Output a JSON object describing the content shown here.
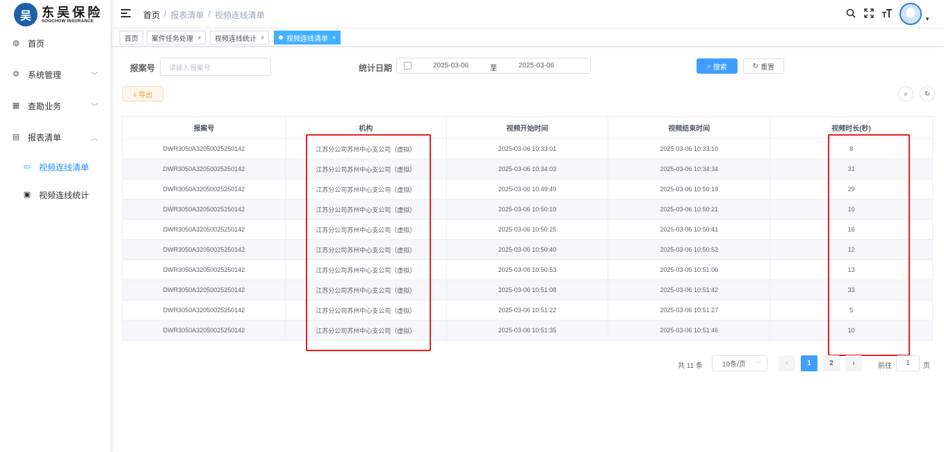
{
  "brand": {
    "name_cn": "东吴保险",
    "name_en": "SOOCHOW INSURANCE",
    "mark": "吴"
  },
  "sidebar": {
    "items": [
      {
        "label": "首页",
        "icon": "dashboard-icon"
      },
      {
        "label": "系统管理",
        "icon": "gear-icon"
      },
      {
        "label": "查勘业务",
        "icon": "grid-icon"
      },
      {
        "label": "报表清单",
        "icon": "report-icon"
      }
    ],
    "sub_items": [
      {
        "label": "视频连线清单",
        "icon": "monitor-icon",
        "active": true
      },
      {
        "label": "视频连线统计",
        "icon": "chart-icon",
        "active": false
      }
    ]
  },
  "header": {
    "breadcrumb": [
      "首页",
      "/",
      "报表清单",
      "/",
      "视频连线清单"
    ],
    "icons": [
      "search-icon",
      "fullscreen-icon",
      "font-size-icon"
    ]
  },
  "tags": [
    {
      "label": "首页",
      "closable": false
    },
    {
      "label": "案件任务处理",
      "closable": true
    },
    {
      "label": "视频连线统计",
      "closable": true
    },
    {
      "label": "视频连线清单",
      "closable": true,
      "active": true
    }
  ],
  "search": {
    "report_label": "报案号",
    "report_placeholder": "请输入报案号",
    "date_label": "统计日期",
    "date_start": "2025-03-06",
    "date_sep": "至",
    "date_end": "2025-03-06",
    "search_btn": "搜索",
    "reset_btn": "重置",
    "export_btn": "导出"
  },
  "table": {
    "headers": [
      "报案号",
      "机构",
      "视频开始时间",
      "视频结束时间",
      "视频时长(秒)"
    ],
    "rows": [
      [
        "DWR3050A32050025250142",
        "江苏分公司苏州中心支公司（虚拟）",
        "2025-03-06 10:33:01",
        "2025-03-06 10:33:10",
        "8"
      ],
      [
        "DWR3050A32050025250142",
        "江苏分公司苏州中心支公司（虚拟）",
        "2025-03-06 10:34:03",
        "2025-03-06 10:34:34",
        "31"
      ],
      [
        "DWR3050A32050025250142",
        "江苏分公司苏州中心支公司（虚拟）",
        "2025-03-06 10:49:49",
        "2025-03-06 10:50:19",
        "29"
      ],
      [
        "DWR3050A32050025250142",
        "江苏分公司苏州中心支公司（虚拟）",
        "2025-03-06 10:50:10",
        "2025-03-06 10:50:21",
        "10"
      ],
      [
        "DWR3050A32050025250142",
        "江苏分公司苏州中心支公司（虚拟）",
        "2025-03-06 10:50:25",
        "2025-03-06 10:50:41",
        "16"
      ],
      [
        "DWR3050A32050025250142",
        "江苏分公司苏州中心支公司（虚拟）",
        "2025-03-06 10:50:40",
        "2025-03-06 10:50:52",
        "12"
      ],
      [
        "DWR3050A32050025250142",
        "江苏分公司苏州中心支公司（虚拟）",
        "2025-03-06 10:50:53",
        "2025-03-06 10:51:06",
        "13"
      ],
      [
        "DWR3050A32050025250142",
        "江苏分公司苏州中心支公司（虚拟）",
        "2025-03-06 10:51:08",
        "2025-03-06 10:51:42",
        "33"
      ],
      [
        "DWR3050A32050025250142",
        "江苏分公司苏州中心支公司（虚拟）",
        "2025-03-06 10:51:22",
        "2025-03-06 10:51:27",
        "5"
      ],
      [
        "DWR3050A32050025250142",
        "江苏分公司苏州中心支公司（虚拟）",
        "2025-03-06 10:51:35",
        "2025-03-06 10:51:46",
        "10"
      ]
    ]
  },
  "pagination": {
    "total": "共 11 条",
    "page_size": "10条/页",
    "pages": [
      "1",
      "2"
    ],
    "current": "1",
    "goto_label": "前往",
    "goto_value": "1",
    "page_suffix": "页"
  },
  "colors": {
    "primary": "#409eff",
    "annotation": "#e61e1e",
    "brand": "#1d5fa8"
  }
}
